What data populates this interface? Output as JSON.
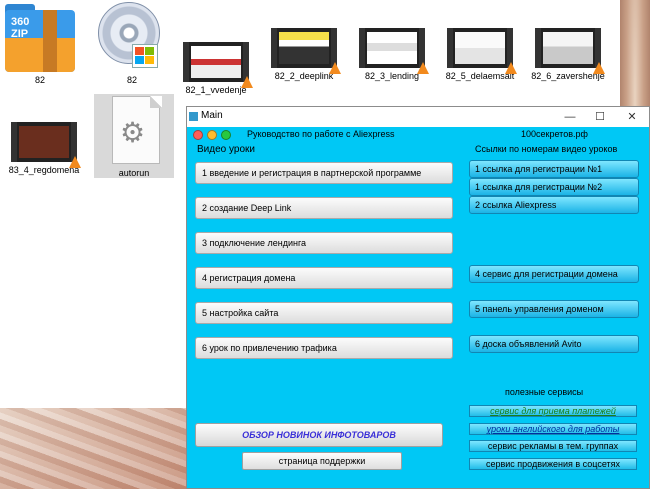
{
  "desktop": {
    "icons": [
      {
        "label": "82",
        "zip_text": "360\nZIP"
      },
      {
        "label": "82"
      },
      {
        "label": "82_1_vvedenje"
      },
      {
        "label": "82_2_deeplink"
      },
      {
        "label": "82_3_lending"
      },
      {
        "label": "82_5_delaemsait"
      },
      {
        "label": "82_6_zavershenje"
      },
      {
        "label": "83_4_regdomena"
      },
      {
        "label": "autorun"
      }
    ]
  },
  "window": {
    "title": "Main",
    "controls": {
      "minimize": "—",
      "maximize": "☐",
      "close": "✕"
    },
    "header_left": "Руководство по работе с Aliexpress",
    "header_right": "100секретов.рф",
    "section_left": "Видео уроки",
    "section_right": "Ссылки по номерам видео уроков",
    "lessons": [
      "1 введение и регистрация в партнерской программе",
      "2 создание Deep Link",
      "3 подключение лендинга",
      "4 регистрация домена",
      "5 настройка сайта",
      "6 урок по привлечению трафика"
    ],
    "links": [
      "1 ссылка для регистрации №1",
      "1 ссылка для регистрации №2",
      "2 ссылка Aliexpress",
      "4 сервис для регистрации домена",
      "5 панель управления доменом",
      "6 доска объявлений Avito"
    ],
    "services_title": "полезные сервисы",
    "services": [
      "сервис для приема платежей",
      "уроки английского для работы",
      "сервис рекламы в тем. группах",
      "сервис продвижения в соцсетях"
    ],
    "promo_button": "ОБЗОР НОВИНОК ИНФОТОВАРОВ",
    "support_button": "страница поддержки"
  },
  "colors": {
    "window_bg": "#00c8f5",
    "link_button": "#1ab3e6",
    "promo_text": "#3a2fd8",
    "service_green": "#1a7f1a",
    "service_blue": "#002fa0"
  }
}
